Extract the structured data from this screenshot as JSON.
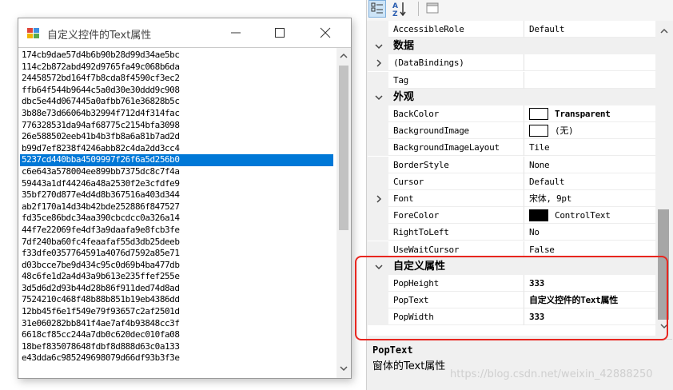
{
  "window": {
    "title": "自定义控件的Text属性",
    "list_items": [
      "174cb9dae57d4b6b90b28d99d34ae5bc",
      "114c2b872abd492d9765fa49c068b6da",
      "24458572bd164f7b8cda8f4590cf3ec2",
      "ffb64f544b9644c5a0d30e30ddd9c908",
      "dbc5e44d067445a0afbb761e36828b5c",
      "3b88e73d66064b32994f712d4f314fac",
      "776328531da94af68775c2154bfa3098",
      "26e588502eeb41b4b3fb8a6a81b7ad2d",
      "b99d7ef8238f4246abb82c4da2dd3cc4",
      "5237cd440bba4509997f26f6a5d256b0",
      "c6e643a578004ee899bb7375dc8c7f4a",
      "59443a1df44246a48a2530f2e3cfdfe9",
      "35bf270d877e4d4d8b367516a403d344",
      "ab2f170a14d34b42bde252886f847527",
      "fd35ce86bdc34aa390cbcdcc0a326a14",
      "44f7e22069fe4df3a9daafa9e8fcb3fe",
      "7df240ba60fc4feaafaf55d3db25deeb",
      "f33dfe0357764591a4076d7592a85e71",
      "d03bcce7be9d434c95c0d69b4ba477db",
      "48c6fe1d2a4d43a9b613e235ffef255e",
      "3d5d6d2d93b44d28b86f911ded74d8ad",
      "7524210c468f48b88b851b19eb4386dd",
      "12bb45f6e1f549e79f93657c2af2501d",
      "31e060282bb841f4ae7af4b93848cc3f",
      "6618cf85cc244a7db0c620dec010fa08",
      "18bef835078648fdbf8d888d63c0a133",
      "e43dda6c985249698079d66df93b3f3e"
    ],
    "selected_index": 9
  },
  "toolbar": {
    "categorized_icon": "categorized-icon",
    "alphabetical_icon": "alphabetical-icon",
    "property_pages_icon": "property-pages-icon"
  },
  "property_grid": {
    "rows": [
      {
        "kind": "prop",
        "name": "AccessibleRole",
        "value": "Default"
      },
      {
        "kind": "category",
        "label": "数据",
        "state": "expanded"
      },
      {
        "kind": "prop",
        "name": "(DataBindings)",
        "value": "",
        "expandable": true
      },
      {
        "kind": "prop",
        "name": "Tag",
        "value": ""
      },
      {
        "kind": "category",
        "label": "外观",
        "state": "expanded"
      },
      {
        "kind": "prop",
        "name": "BackColor",
        "value": "Transparent",
        "swatch": "#ffffff",
        "bold": true
      },
      {
        "kind": "prop",
        "name": "BackgroundImage",
        "value": "(无)",
        "swatch": "#ffffff"
      },
      {
        "kind": "prop",
        "name": "BackgroundImageLayout",
        "value": "Tile"
      },
      {
        "kind": "prop",
        "name": "BorderStyle",
        "value": "None"
      },
      {
        "kind": "prop",
        "name": "Cursor",
        "value": "Default"
      },
      {
        "kind": "prop",
        "name": "Font",
        "value": "宋体, 9pt",
        "expandable": true
      },
      {
        "kind": "prop",
        "name": "ForeColor",
        "value": "ControlText",
        "swatch": "#000000"
      },
      {
        "kind": "prop",
        "name": "RightToLeft",
        "value": "No"
      },
      {
        "kind": "prop",
        "name": "UseWaitCursor",
        "value": "False"
      },
      {
        "kind": "category",
        "label": "自定义属性",
        "state": "expanded"
      },
      {
        "kind": "prop",
        "name": "PopHeight",
        "value": "333",
        "bold": true
      },
      {
        "kind": "prop",
        "name": "PopText",
        "value": "自定义控件的Text属性",
        "bold": true
      },
      {
        "kind": "prop",
        "name": "PopWidth",
        "value": "333",
        "bold": true
      }
    ]
  },
  "description": {
    "name": "PopText",
    "text": "窗体的Text属性"
  },
  "watermark": "https://blog.csdn.net/weixin_42888250",
  "colors": {
    "selection": "#0078d7",
    "highlight_border": "#e8261f",
    "panel_bg": "#f0f0f0"
  }
}
